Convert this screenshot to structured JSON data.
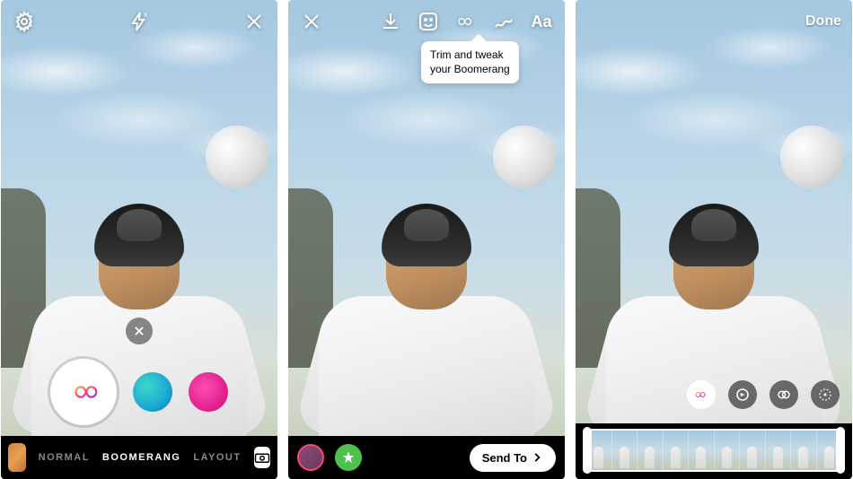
{
  "screen1": {
    "modes": [
      "NORMAL",
      "BOOMERANG",
      "LAYOUT"
    ],
    "active_mode_index": 1
  },
  "screen2": {
    "tooltip": "Trim and tweak\nyour Boomerang",
    "text_tool": "Aa",
    "send_to": "Send To"
  },
  "screen3": {
    "done": "Done"
  }
}
